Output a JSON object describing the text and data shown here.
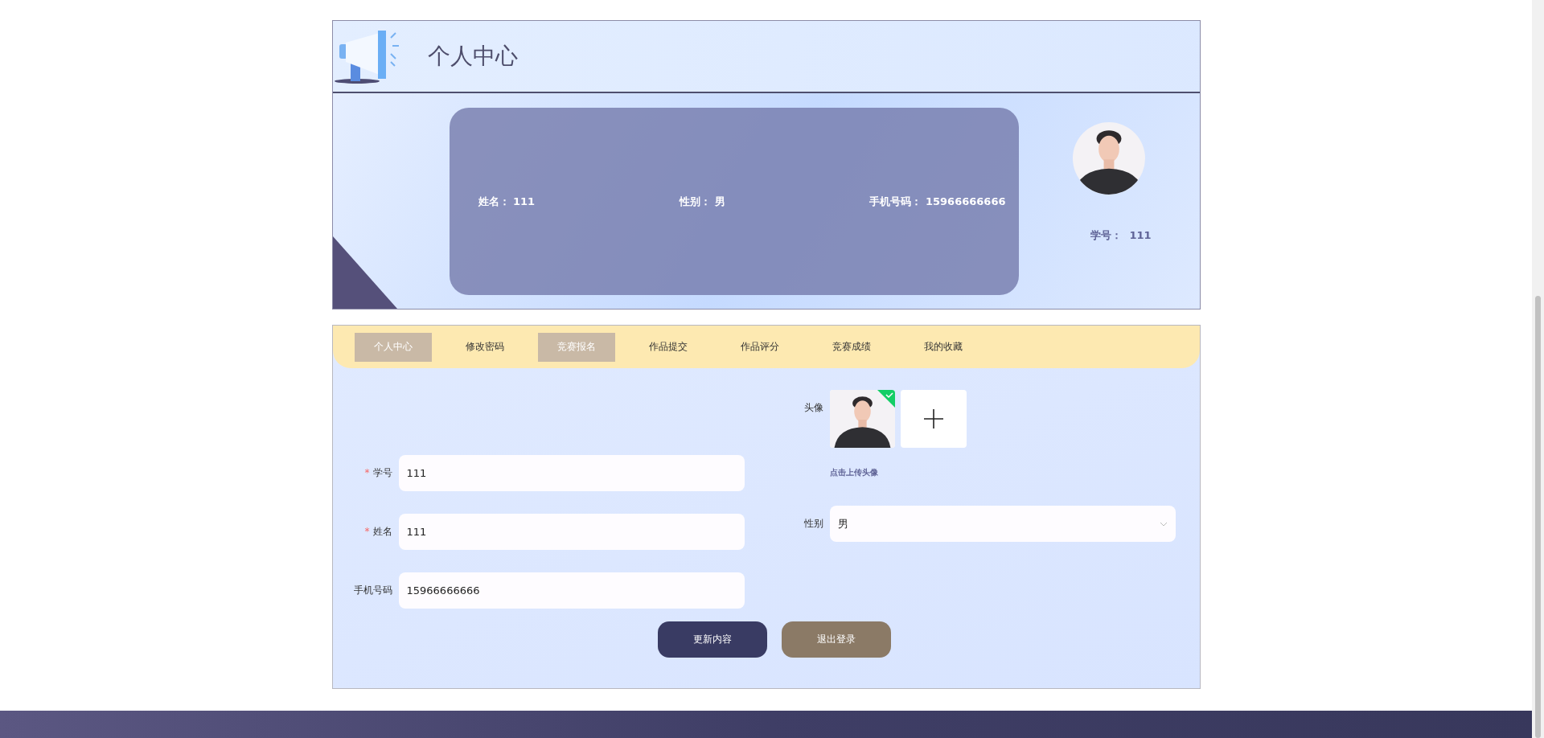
{
  "header": {
    "title": "个人中心"
  },
  "profile": {
    "fields": [
      {
        "label": "姓名：",
        "value": "111"
      },
      {
        "label": "性别：",
        "value": "男"
      },
      {
        "label": "手机号码：",
        "value": "15966666666"
      }
    ],
    "student_id": {
      "label": "学号：",
      "value": "111"
    }
  },
  "tabs": [
    {
      "label": "个人中心",
      "selected": true
    },
    {
      "label": "修改密码",
      "selected": false
    },
    {
      "label": "竞赛报名",
      "selected": true
    },
    {
      "label": "作品提交",
      "selected": false
    },
    {
      "label": "作品评分",
      "selected": false
    },
    {
      "label": "竞赛成绩",
      "selected": false
    },
    {
      "label": "我的收藏",
      "selected": false
    }
  ],
  "form": {
    "left": [
      {
        "label": "学号",
        "required_mark": "*",
        "value": "111"
      },
      {
        "label": "姓名",
        "required_mark": "*",
        "value": "111"
      },
      {
        "label": "手机号码",
        "value": "15966666666"
      }
    ],
    "avatar": {
      "label": "头像",
      "hint": "点击上传头像",
      "uploaded": true
    },
    "gender": {
      "label": "性别",
      "value": "男"
    }
  },
  "buttons": [
    {
      "label": "更新内容",
      "kind": "primary"
    },
    {
      "label": "退出登录",
      "kind": "secondary"
    }
  ]
}
